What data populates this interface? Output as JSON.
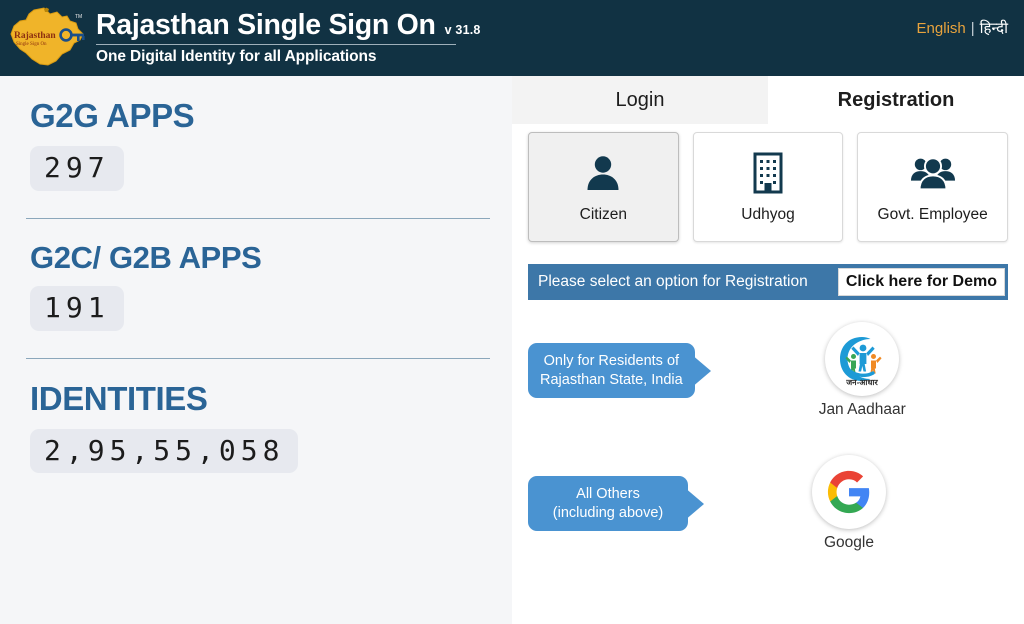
{
  "header": {
    "logo_icon": "rajasthan-state-map-logo",
    "title": "Rajasthan Single Sign On",
    "version": "v 31.8",
    "subtitle": "One Digital Identity for all Applications",
    "language": {
      "english": "English",
      "separator": "|",
      "hindi": "हिन्दी",
      "active_color": "#e8a33d"
    }
  },
  "stats": [
    {
      "label": "G2G APPS",
      "value": "297"
    },
    {
      "label": "G2C/ G2B APPS",
      "value": "191"
    },
    {
      "label": "IDENTITIES",
      "value": "2,95,55,058"
    }
  ],
  "tabs": [
    {
      "label": "Login",
      "active": false
    },
    {
      "label": "Registration",
      "active": true
    }
  ],
  "registration_types": [
    {
      "label": "Citizen",
      "icon": "person-icon",
      "selected": true
    },
    {
      "label": "Udhyog",
      "icon": "building-icon",
      "selected": false
    },
    {
      "label": "Govt. Employee",
      "icon": "people-group-icon",
      "selected": false
    }
  ],
  "notice": {
    "text": "Please select an option for Registration",
    "demo_button": "Click here for Demo",
    "background_color": "#3d77a8"
  },
  "options": [
    {
      "callout_lines": [
        "Only for Residents of",
        "Rajasthan State, India"
      ],
      "brand_label": "Jan Aadhaar",
      "brand_icon": "jan-aadhaar-logo",
      "brand_script_text": "जन-आधार",
      "callout_color": "#4a93d1"
    },
    {
      "callout_lines": [
        "All Others",
        "(including above)"
      ],
      "brand_label": "Google",
      "brand_icon": "google-logo",
      "callout_color": "#4a93d1"
    }
  ],
  "theme": {
    "header_bg": "#113243",
    "left_panel_bg": "#f5f6f8",
    "stat_label_color": "#2a6496",
    "counter_chip_bg": "#e7e9ef",
    "icon_dark": "#12394e"
  }
}
